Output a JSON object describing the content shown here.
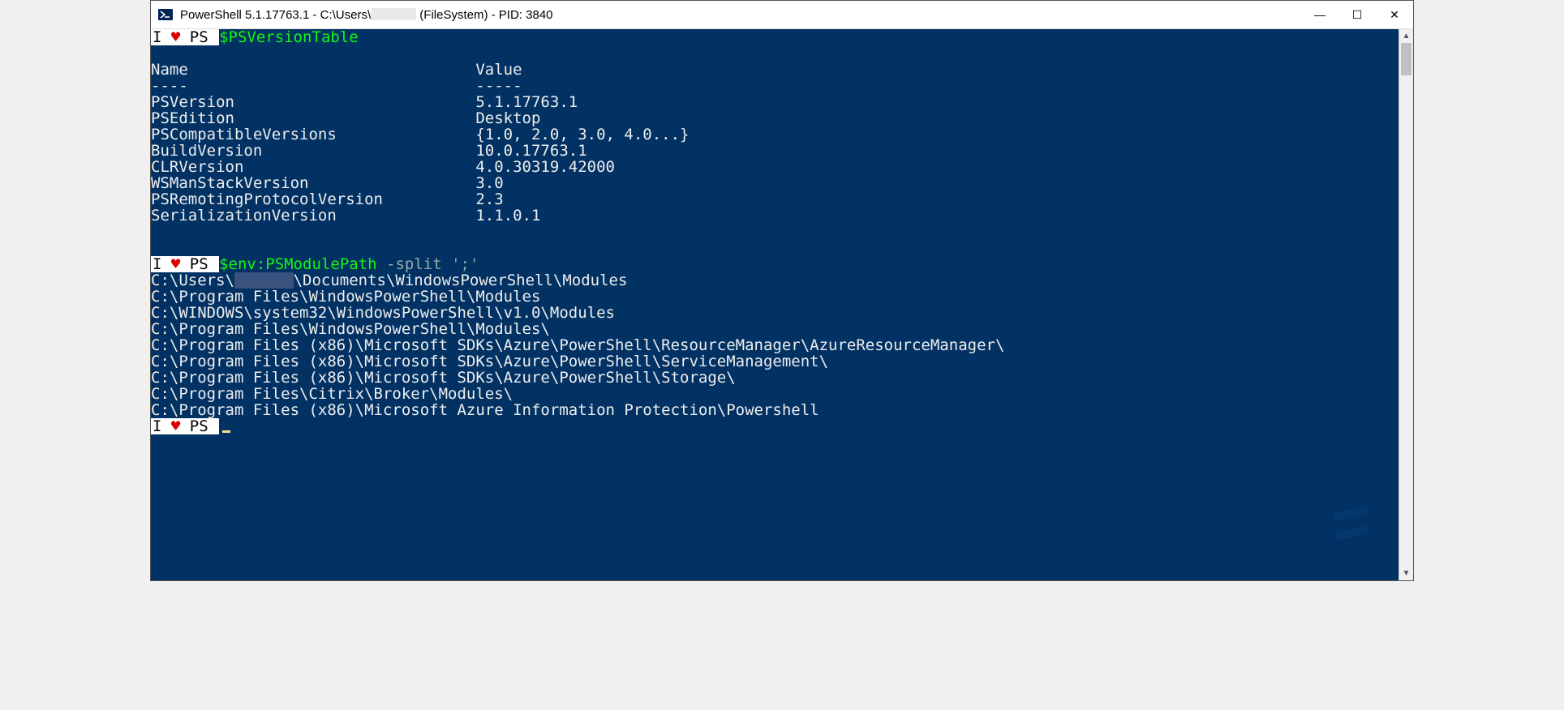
{
  "titlebar": {
    "prefix": "PowerShell 5.1.17763.1 - C:\\Users\\",
    "suffix": " (FileSystem) - PID: 3840"
  },
  "prompt": {
    "left": "I ",
    "heart": "♥",
    "ps": " PS ",
    "cmd1": "$PSVersionTable",
    "cmd2a": "$env:PSModulePath",
    "cmd2b": " -split ",
    "cmd2c": "';'"
  },
  "headers": {
    "name": "Name",
    "value": "Value",
    "dash1": "----",
    "dash2": "-----",
    "padTo": 35
  },
  "rows": [
    {
      "k": "PSVersion",
      "v": "5.1.17763.1"
    },
    {
      "k": "PSEdition",
      "v": "Desktop"
    },
    {
      "k": "PSCompatibleVersions",
      "v": "{1.0, 2.0, 3.0, 4.0...}"
    },
    {
      "k": "BuildVersion",
      "v": "10.0.17763.1"
    },
    {
      "k": "CLRVersion",
      "v": "4.0.30319.42000"
    },
    {
      "k": "WSManStackVersion",
      "v": "3.0"
    },
    {
      "k": "PSRemotingProtocolVersion",
      "v": "2.3"
    },
    {
      "k": "SerializationVersion",
      "v": "1.1.0.1"
    }
  ],
  "paths": {
    "p0_pre": "C:\\Users\\",
    "p0_post": "\\Documents\\WindowsPowerShell\\Modules",
    "rest": [
      "C:\\Program Files\\WindowsPowerShell\\Modules",
      "C:\\WINDOWS\\system32\\WindowsPowerShell\\v1.0\\Modules",
      "C:\\Program Files\\WindowsPowerShell\\Modules\\",
      "C:\\Program Files (x86)\\Microsoft SDKs\\Azure\\PowerShell\\ResourceManager\\AzureResourceManager\\",
      "C:\\Program Files (x86)\\Microsoft SDKs\\Azure\\PowerShell\\ServiceManagement\\",
      "C:\\Program Files (x86)\\Microsoft SDKs\\Azure\\PowerShell\\Storage\\",
      "C:\\Program Files\\Citrix\\Broker\\Modules\\",
      "C:\\Program Files (x86)\\Microsoft Azure Information Protection\\Powershell"
    ]
  },
  "redacted": "xxxxxx",
  "winbtn": {
    "min": "—",
    "max": "☐",
    "close": "✕"
  },
  "arrows": {
    "up": "▲",
    "down": "▼"
  }
}
